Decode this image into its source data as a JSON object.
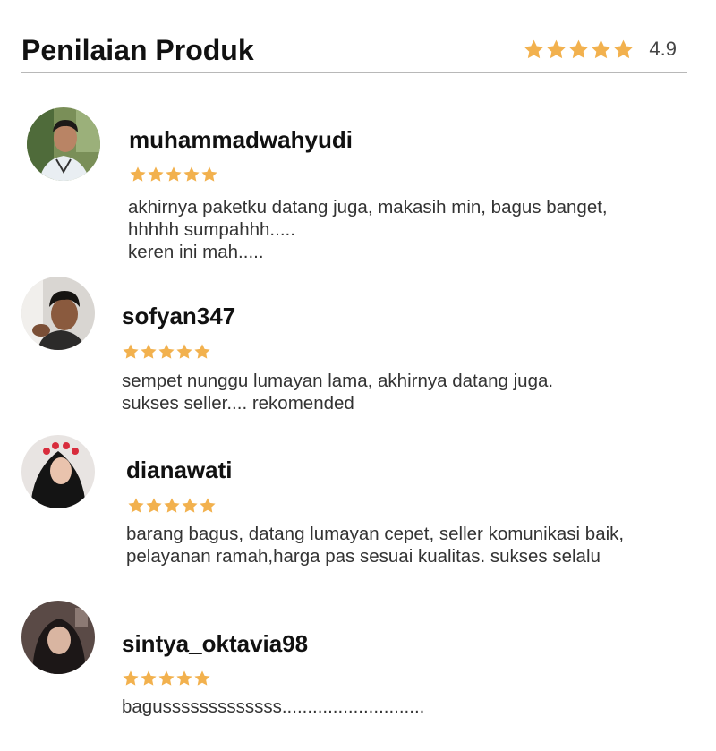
{
  "header": {
    "title": "Penilaian Produk",
    "rating": "4.9",
    "stars": 5,
    "star_color": "#F2B14E"
  },
  "reviews": [
    {
      "username": "muhammadwahyudi",
      "stars": 5,
      "text": "akhirnya paketku datang juga, makasih min, bagus banget,\nhhhhh sumpahhh.....\nkeren ini mah....."
    },
    {
      "username": "sofyan347",
      "stars": 5,
      "text": "sempet nunggu lumayan lama, akhirnya datang juga.\nsukses seller.... rekomended"
    },
    {
      "username": "dianawati",
      "stars": 5,
      "text": "barang bagus, datang lumayan cepet, seller komunikasi baik,\npelayanan ramah,harga pas sesuai kualitas. sukses selalu"
    },
    {
      "username": "sintya_oktavia98",
      "stars": 5,
      "text": "bagusssssssssssss............................"
    }
  ]
}
